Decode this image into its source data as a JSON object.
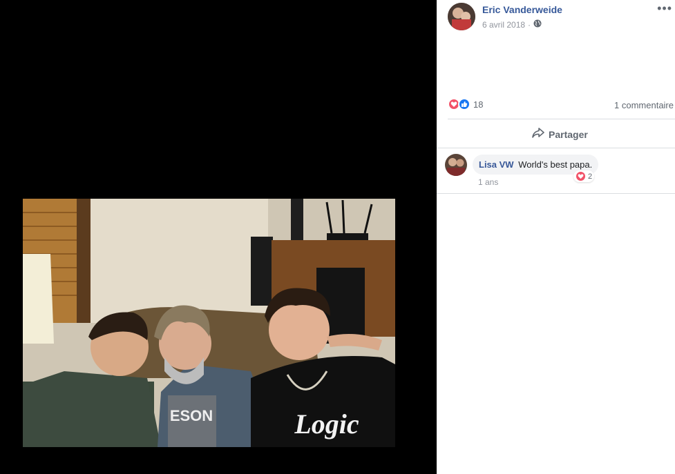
{
  "post": {
    "author": "Eric Vanderweide",
    "date": "6 avril 2018",
    "privacy_icon": "globe-icon",
    "more_label": "•••",
    "reactions": {
      "icons": [
        "love-icon",
        "like-icon"
      ],
      "count": "18"
    },
    "comments_count_label": "1 commentaire",
    "share_label": "Partager",
    "photo_text": {
      "shirt_middle": "ESON",
      "shirt_right": "Logic"
    }
  },
  "comment": {
    "author": "Lisa VW",
    "text": "World's best papa.",
    "time": "1 ans",
    "reaction_count": "2"
  },
  "colors": {
    "link": "#365899",
    "secondary_text": "#90949c",
    "love": "#f25268",
    "like": "#1877f2"
  }
}
